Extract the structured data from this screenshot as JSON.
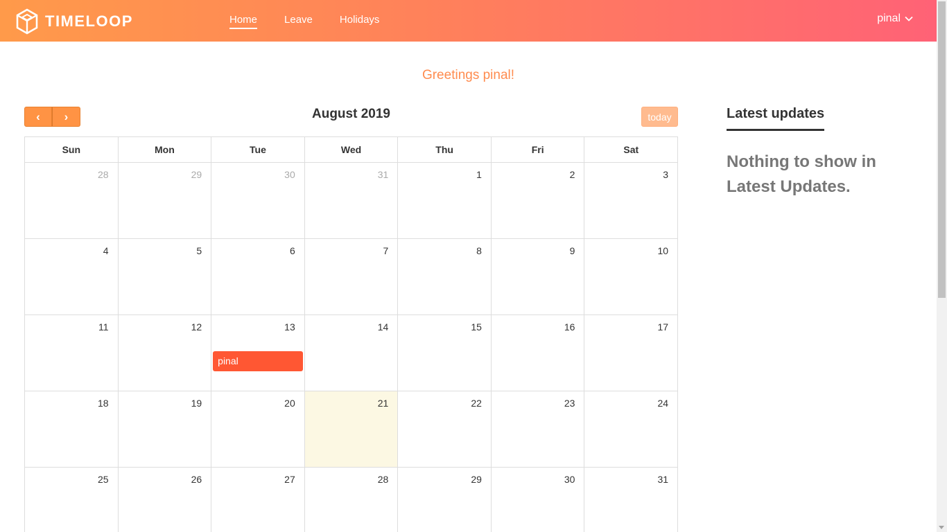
{
  "header": {
    "brand": "TIMELOOP",
    "nav": [
      {
        "label": "Home",
        "active": true
      },
      {
        "label": "Leave",
        "active": false
      },
      {
        "label": "Holidays",
        "active": false
      }
    ],
    "user": "pinal",
    "user_icon": "chevron-down-icon",
    "logo_icon": "hexagon-cube-logo-icon",
    "gradient": [
      "#ff9a4a",
      "#ff6276"
    ]
  },
  "greeting": "Greetings pinal!",
  "calendar": {
    "title": "August 2019",
    "prev_icon": "chevron-left-icon",
    "next_icon": "chevron-right-icon",
    "prev_label": "‹",
    "next_label": "›",
    "today_label": "today",
    "accent": "#ff9344",
    "days_of_week": [
      "Sun",
      "Mon",
      "Tue",
      "Wed",
      "Thu",
      "Fri",
      "Sat"
    ],
    "weeks": [
      [
        {
          "d": "28",
          "other": true
        },
        {
          "d": "29",
          "other": true
        },
        {
          "d": "30",
          "other": true
        },
        {
          "d": "31",
          "other": true
        },
        {
          "d": "1"
        },
        {
          "d": "2"
        },
        {
          "d": "3"
        }
      ],
      [
        {
          "d": "4"
        },
        {
          "d": "5"
        },
        {
          "d": "6"
        },
        {
          "d": "7"
        },
        {
          "d": "8"
        },
        {
          "d": "9"
        },
        {
          "d": "10"
        }
      ],
      [
        {
          "d": "11"
        },
        {
          "d": "12"
        },
        {
          "d": "13",
          "event": "pinal"
        },
        {
          "d": "14"
        },
        {
          "d": "15"
        },
        {
          "d": "16"
        },
        {
          "d": "17"
        }
      ],
      [
        {
          "d": "18"
        },
        {
          "d": "19"
        },
        {
          "d": "20"
        },
        {
          "d": "21",
          "today": true
        },
        {
          "d": "22"
        },
        {
          "d": "23"
        },
        {
          "d": "24"
        }
      ],
      [
        {
          "d": "25"
        },
        {
          "d": "26"
        },
        {
          "d": "27"
        },
        {
          "d": "28"
        },
        {
          "d": "29"
        },
        {
          "d": "30"
        },
        {
          "d": "31"
        }
      ]
    ],
    "event_color": "#ff5733",
    "today_color": "#fcf8e3"
  },
  "sidebar": {
    "title": "Latest updates",
    "empty_text": "Nothing to show in Latest Updates."
  }
}
